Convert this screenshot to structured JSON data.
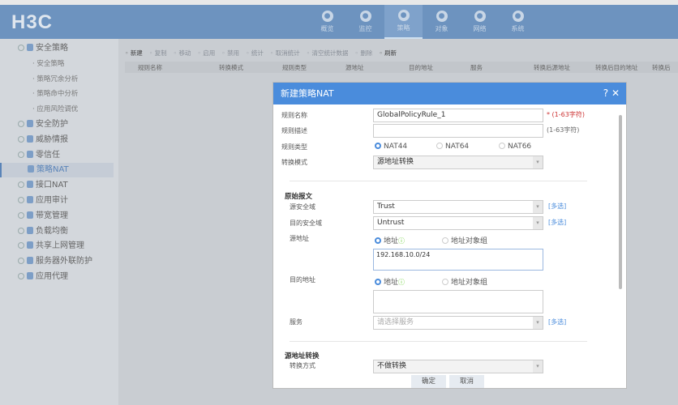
{
  "header": {
    "logo": "H3C",
    "nav": [
      {
        "label": "概览",
        "icon": "dashboard-icon"
      },
      {
        "label": "监控",
        "icon": "monitor-icon"
      },
      {
        "label": "策略",
        "icon": "shield-icon",
        "active": true
      },
      {
        "label": "对象",
        "icon": "share-icon"
      },
      {
        "label": "网络",
        "icon": "globe-icon"
      },
      {
        "label": "系统",
        "icon": "system-icon"
      }
    ]
  },
  "sidebar": {
    "items": [
      {
        "label": "安全策略",
        "type": "group"
      },
      {
        "label": "· 安全策略",
        "type": "sub"
      },
      {
        "label": "· 策略冗余分析",
        "type": "sub"
      },
      {
        "label": "· 策略命中分析",
        "type": "sub"
      },
      {
        "label": "· 应用风险调优",
        "type": "sub"
      },
      {
        "label": "安全防护",
        "type": "group"
      },
      {
        "label": "威胁情报",
        "type": "group"
      },
      {
        "label": "零信任",
        "type": "group"
      },
      {
        "label": "策略NAT",
        "type": "active"
      },
      {
        "label": "接口NAT",
        "type": "group"
      },
      {
        "label": "应用审计",
        "type": "group"
      },
      {
        "label": "带宽管理",
        "type": "group"
      },
      {
        "label": "负载均衡",
        "type": "group"
      },
      {
        "label": "共享上网管理",
        "type": "group"
      },
      {
        "label": "服务器外联防护",
        "type": "group"
      },
      {
        "label": "应用代理",
        "type": "group"
      }
    ]
  },
  "toolbar": [
    "新建",
    "复制",
    "移动",
    "启用",
    "禁用",
    "统计",
    "取消统计",
    "清空统计数据",
    "删除",
    "刷新"
  ],
  "table": {
    "columns": [
      "规则名称",
      "转换模式",
      "规则类型",
      "源地址",
      "目的地址",
      "服务",
      "转换后源地址",
      "转换后目的地址",
      "转换后"
    ]
  },
  "modal": {
    "title": "新建策略NAT",
    "help": "?",
    "close": "✕",
    "rule_name_label": "规则名称",
    "rule_name_value": "GlobalPolicyRule_1",
    "rule_name_hint": "* (1-63字符)",
    "rule_desc_label": "规则描述",
    "rule_desc_value": "",
    "rule_desc_hint": "(1-63字符)",
    "rule_type_label": "规则类型",
    "rule_types": [
      "NAT44",
      "NAT64",
      "NAT66"
    ],
    "rule_type_selected": "NAT44",
    "mode_label": "转换模式",
    "mode_value": "源地址转换",
    "section_match": "原始报文",
    "src_zone_label": "源安全域",
    "src_zone_value": "Trust",
    "dst_zone_label": "目的安全域",
    "dst_zone_value": "Untrust",
    "multi": "[多选]",
    "src_addr_label": "源地址",
    "addr_option": "地址",
    "addr_group_option": "地址对象组",
    "src_addr_value": "192.168.10.0/24",
    "dst_addr_label": "目的地址",
    "dst_addr_value": "",
    "service_label": "服务",
    "service_placeholder": "请选择服务",
    "section_src_nat": "源地址转换",
    "nat_method_label": "转换方式",
    "nat_method_value": "不做转换",
    "ok": "确定",
    "cancel": "取消"
  }
}
